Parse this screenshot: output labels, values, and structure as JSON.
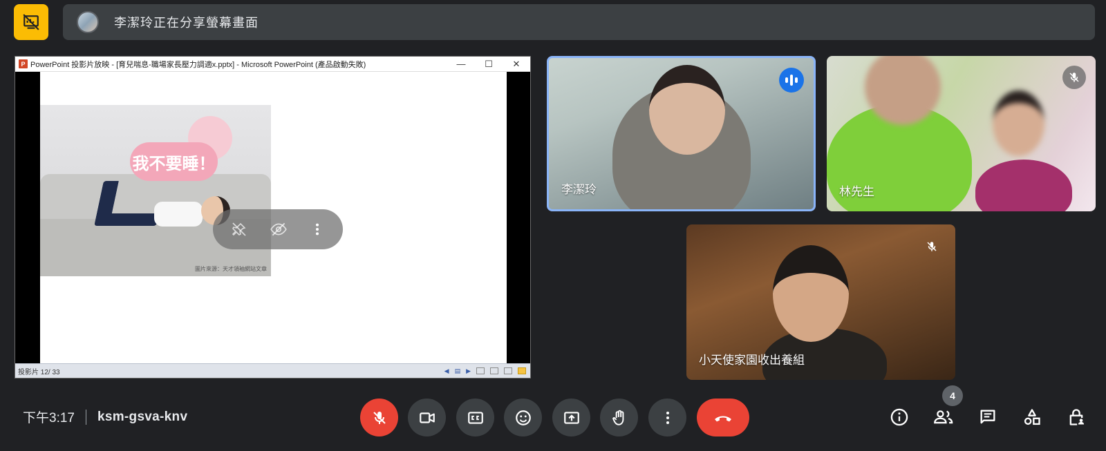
{
  "top_bar": {
    "present_icon": "no-presentation-icon",
    "banner_text": "李潔玲正在分享螢幕畫面"
  },
  "presentation": {
    "window_title": "PowerPoint 投影片放映 - [育兒喘息-職場家長壓力調適x.pptx] - Microsoft PowerPoint (產品啟動失敗)",
    "app_logo": "P",
    "minimize": "—",
    "maximize": "☐",
    "close": "✕",
    "slide_bubble": "我不要睡！",
    "photo_credit": "圖片來源：天才領袖網站文章",
    "status_text": "投影片 12/ 33"
  },
  "participants": [
    {
      "name": "李潔玲",
      "state": "speaking"
    },
    {
      "name": "林先生",
      "state": "muted"
    },
    {
      "name": "小天使家園收出養組",
      "state": "muted"
    }
  ],
  "meeting": {
    "time": "下午3:17",
    "code": "ksm-gsva-knv"
  },
  "side": {
    "participant_count": "4"
  },
  "colors": {
    "background": "#202124",
    "surface": "#3c4043",
    "danger": "#ea4335",
    "accent_yellow": "#fbbc04",
    "speaking_blue": "#1a73e8",
    "active_border": "#8ab4f8"
  }
}
